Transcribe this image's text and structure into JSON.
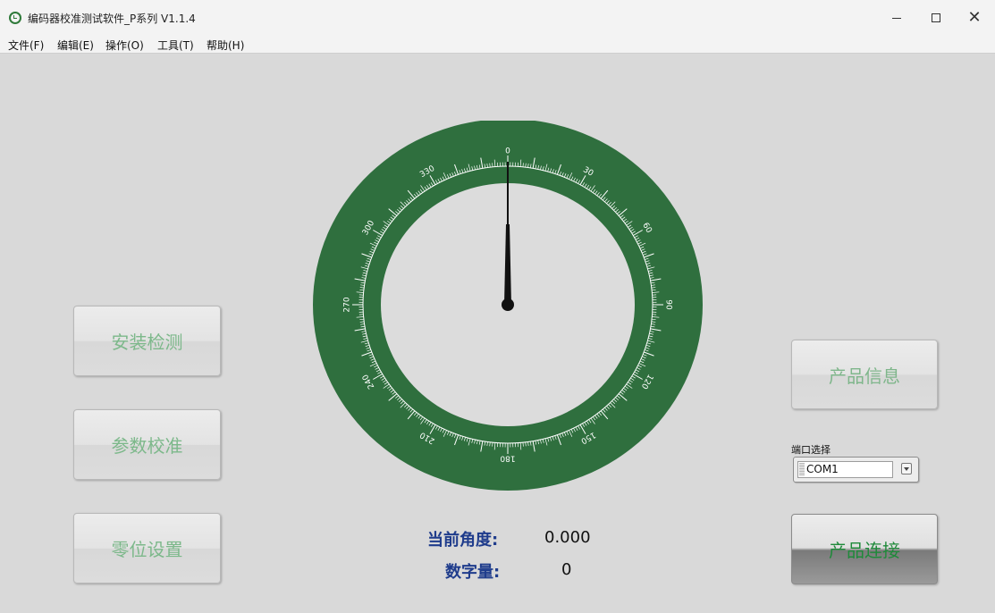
{
  "window": {
    "title": "编码器校准测试软件_P系列 V1.1.4"
  },
  "menu": [
    {
      "label": "文件(F)"
    },
    {
      "label": "编辑(E)"
    },
    {
      "label": "操作(O)"
    },
    {
      "label": "工具(T)"
    },
    {
      "label": "帮助(H)"
    }
  ],
  "left_buttons": {
    "install_check": "安装检测",
    "param_calibration": "参数校准",
    "zero_setting": "零位设置"
  },
  "right": {
    "product_info": "产品信息",
    "port_label": "端口选择",
    "port_value": "COM1",
    "connect": "产品连接"
  },
  "dial": {
    "labels": [
      "0",
      "30",
      "60",
      "90",
      "120",
      "150",
      "180",
      "210",
      "240",
      "270",
      "300",
      "330"
    ],
    "needle_angle_deg": 0,
    "colors": {
      "ring": "#2f6f3e",
      "face": "#dcdcdc",
      "marks": "#ffffff",
      "needle": "#111111"
    }
  },
  "readout": {
    "angle_label": "当前角度:",
    "angle_value": "0.000",
    "digital_label": "数字量:",
    "digital_value": "0"
  }
}
